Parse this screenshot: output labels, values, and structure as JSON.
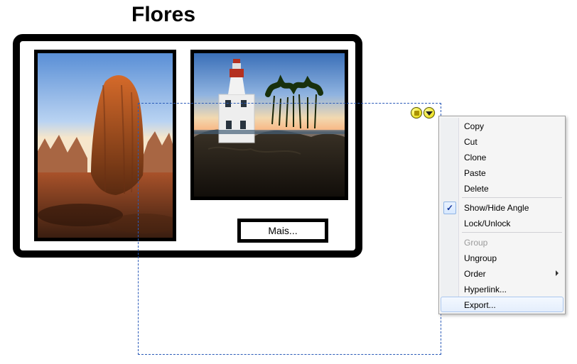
{
  "title": "Flores",
  "more_button": "Mais...",
  "context_menu": {
    "copy": "Copy",
    "cut": "Cut",
    "clone": "Clone",
    "paste": "Paste",
    "delete": "Delete",
    "show_hide_angle": "Show/Hide Angle",
    "lock_unlock": "Lock/Unlock",
    "group": "Group",
    "ungroup": "Ungroup",
    "order": "Order",
    "hyperlink": "Hyperlink...",
    "export": "Export..."
  }
}
